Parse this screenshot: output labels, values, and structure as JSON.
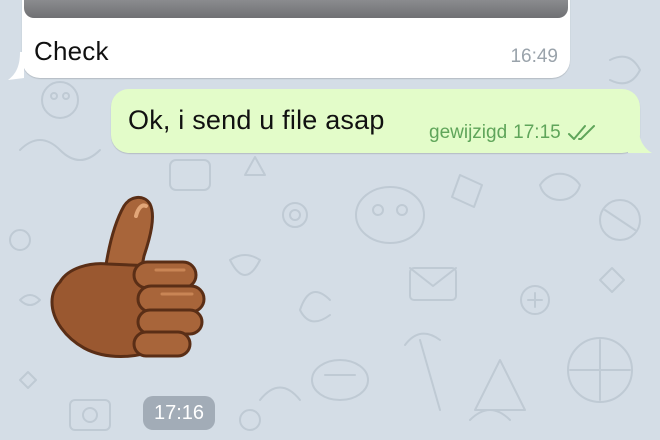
{
  "messages": {
    "incoming": {
      "text": "Check",
      "time": "16:49"
    },
    "outgoing": {
      "text": "Ok, i send u file asap",
      "edited_label": "gewijzigd",
      "time": "17:15",
      "status_icon": "double-check-icon"
    },
    "sticker": {
      "emoji": "thumbs-up",
      "time": "17:16"
    }
  },
  "colors": {
    "chat_background": "#d4dde6",
    "incoming_bubble": "#ffffff",
    "outgoing_bubble": "#e3fcc9",
    "outgoing_meta": "#5fa55a",
    "incoming_time": "#9aa3ab"
  }
}
